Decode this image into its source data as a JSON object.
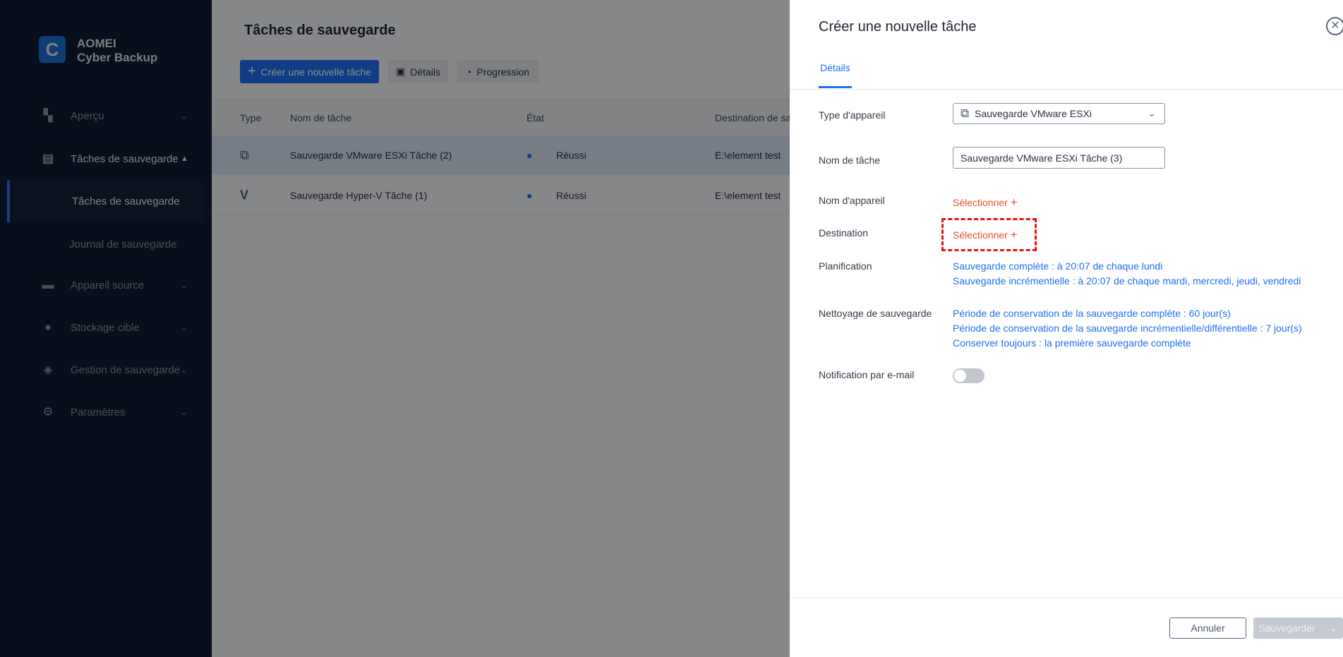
{
  "app": {
    "brand_line1": "AOMEI",
    "brand_line2": "Cyber Backup"
  },
  "sidebar": {
    "items": [
      {
        "label": "Aperçu",
        "icon": "dashboard-icon"
      },
      {
        "label": "Tâches de sauvegarde",
        "icon": "clipboard-icon"
      },
      {
        "label": "Tâches de sauvegarde"
      },
      {
        "label": "Journal de sauvegarde"
      },
      {
        "label": "Appareil source",
        "icon": "monitor-icon"
      },
      {
        "label": "Stockage cible",
        "icon": "location-icon"
      },
      {
        "label": "Gestion de sauvegarde",
        "icon": "layers-icon"
      },
      {
        "label": "Paramètres",
        "icon": "gear-icon"
      }
    ]
  },
  "main": {
    "title": "Tâches de sauvegarde",
    "create_label": "Créer une nouvelle tâche",
    "details_label": "Détails",
    "progress_label": "Progression",
    "columns": [
      "Type",
      "Nom de tâche",
      "État",
      "Destination de sa"
    ],
    "rows": [
      {
        "name": "Sauvegarde VMware ESXi Tâche (2)",
        "status": "Réussi",
        "dest": "E:\\element test"
      },
      {
        "name": "Sauvegarde Hyper-V Tâche (1)",
        "status": "Réussi",
        "dest": "E:\\element test"
      }
    ]
  },
  "panel": {
    "title": "Créer une nouvelle tâche",
    "tab": "Détails",
    "labels": {
      "device_type": "Type d'appareil",
      "task_name": "Nom de tâche",
      "device_name": "Nom d'appareil",
      "destination": "Destination",
      "schedule": "Planification",
      "cleanup": "Nettoyage de sauvegarde",
      "email": "Notification par e-mail"
    },
    "device_type_value": "Sauvegarde VMware ESXi",
    "task_name_value": "Sauvegarde VMware ESXi Tâche (3)",
    "select_label": "Sélectionner",
    "schedule": [
      "Sauvegarde complète : à 20:07 de chaque lundi",
      "Sauvegarde incrémentielle : à 20:07 de chaque mardi, mercredi, jeudi, vendredi"
    ],
    "cleanup": [
      "Période de conservation de la sauvegarde complète : 60 jour(s)",
      "Période de conservation de la sauvegarde incrémentielle/différentielle : 7 jour(s)",
      "Conserver toujours : la première sauvegarde complète"
    ],
    "email_enabled": false,
    "cancel_label": "Annuler",
    "save_label": "Sauvegarder"
  },
  "colors": {
    "accent": "#1f6ff2",
    "select": "#f04a2a",
    "highlight": "#ee1111"
  }
}
